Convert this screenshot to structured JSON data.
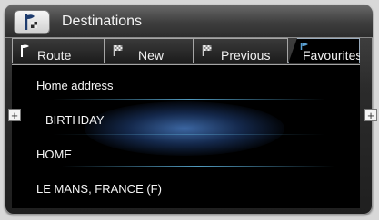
{
  "header": {
    "title": "Destinations",
    "app_icon": "flag-destinations-icon"
  },
  "tabs": [
    {
      "label": "Route",
      "icon": "flag-route-icon"
    },
    {
      "label": "New",
      "icon": "checkered-flag-icon"
    },
    {
      "label": "Previous",
      "icon": "checkered-flag-icon"
    },
    {
      "label": "Favourites",
      "icon": "star-flag-icon",
      "selected": true
    }
  ],
  "list": {
    "items": [
      {
        "label": "Home address"
      },
      {
        "label": "BIRTHDAY",
        "highlighted": true
      },
      {
        "label": "HOME"
      },
      {
        "label": "LE MANS, FRANCE (F)"
      }
    ]
  },
  "side_buttons": {
    "left": "+",
    "right": "+"
  },
  "colors": {
    "accent": "#5aa0d2",
    "background": "#000000",
    "frame": "#2b2b2b"
  }
}
